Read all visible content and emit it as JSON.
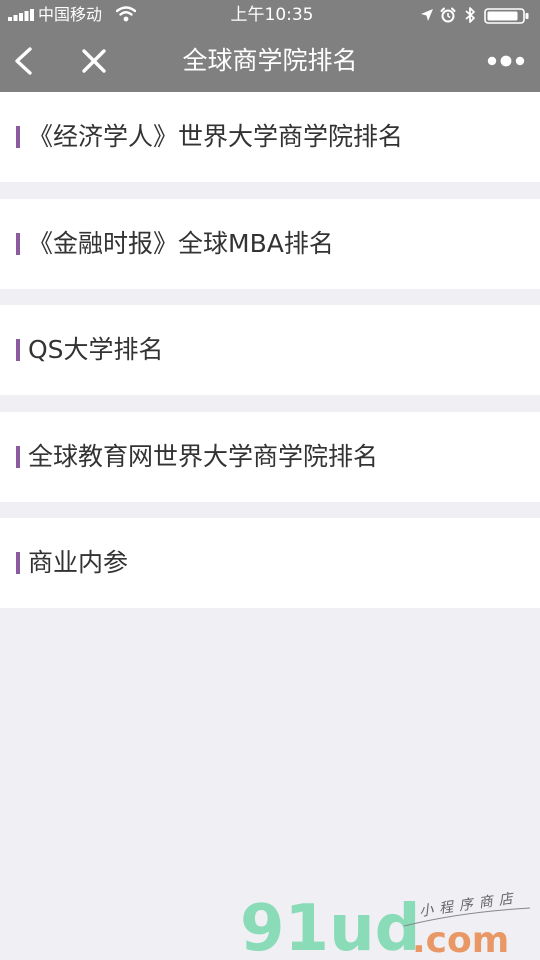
{
  "status_bar": {
    "carrier": "中国移动",
    "time": "上午10:35"
  },
  "nav": {
    "title": "全球商学院排名"
  },
  "list": {
    "items": [
      {
        "label": "《经济学人》世界大学商学院排名"
      },
      {
        "label": "《金融时报》全球MBA排名"
      },
      {
        "label": "QS大学排名"
      },
      {
        "label": "全球教育网世界大学商学院排名"
      },
      {
        "label": "商业内参"
      }
    ]
  },
  "watermark": {
    "brand": "91ud",
    "domain": ".com",
    "tagline": "小程序商店"
  },
  "colors": {
    "header_bg": "#808080",
    "page_bg": "#efeff4",
    "accent_bar": "#8c5a9e",
    "text": "#333333",
    "watermark_green": "#7ed8b0"
  }
}
